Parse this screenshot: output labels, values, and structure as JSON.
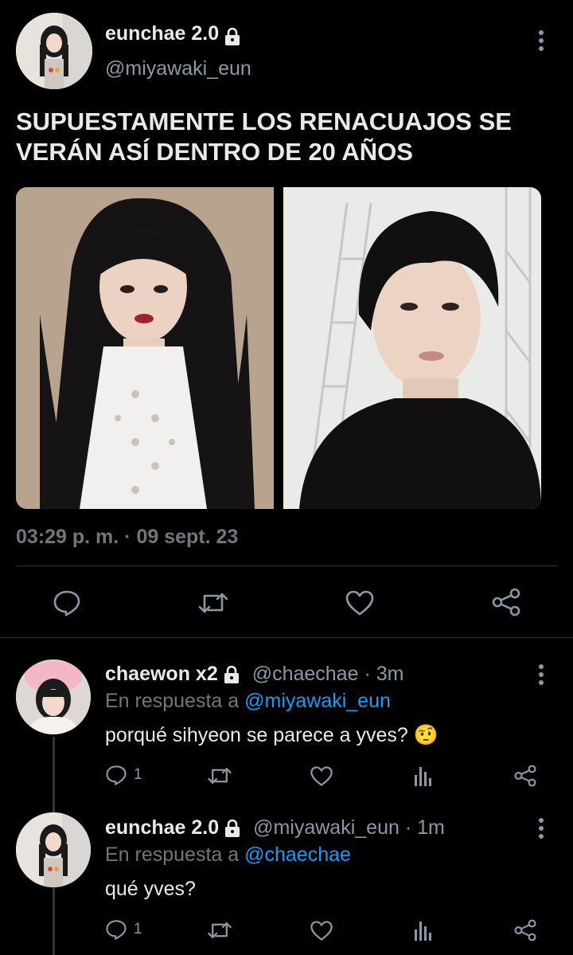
{
  "main_tweet": {
    "display_name": "eunchae 2.0",
    "handle": "@miyawaki_eun",
    "text_line1": "SUPUESTAMENTE LOS RENACUAJOS SE",
    "text_line2": "VERÁN ASÍ DENTRO DE 20 AÑOS",
    "timestamp": "03:29 p. m. · 09 sept. 23",
    "protected_icon": "lock-icon",
    "more_icon": "kebab-icon"
  },
  "actions": {
    "reply": "reply-icon",
    "retweet": "retweet-icon",
    "like": "heart-icon",
    "share": "share-icon"
  },
  "replies": [
    {
      "display_name": "chaewon x2",
      "handle": "@chaechae",
      "time": "· 3m",
      "replying_prefix": "En respuesta a",
      "replying_to": "@miyawaki_eun",
      "text": "porqué sihyeon se parece a yves? 🤨",
      "reply_count": "1"
    },
    {
      "display_name": "eunchae 2.0",
      "handle": "@miyawaki_eun",
      "time": "· 1m",
      "replying_prefix": "En respuesta a",
      "replying_to": "@chaechae",
      "text": "qué yves?",
      "reply_count": "1"
    }
  ],
  "colors": {
    "background": "#000000",
    "link": "#1d9bf0",
    "muted": "#71767b",
    "divider": "#2f3336"
  }
}
